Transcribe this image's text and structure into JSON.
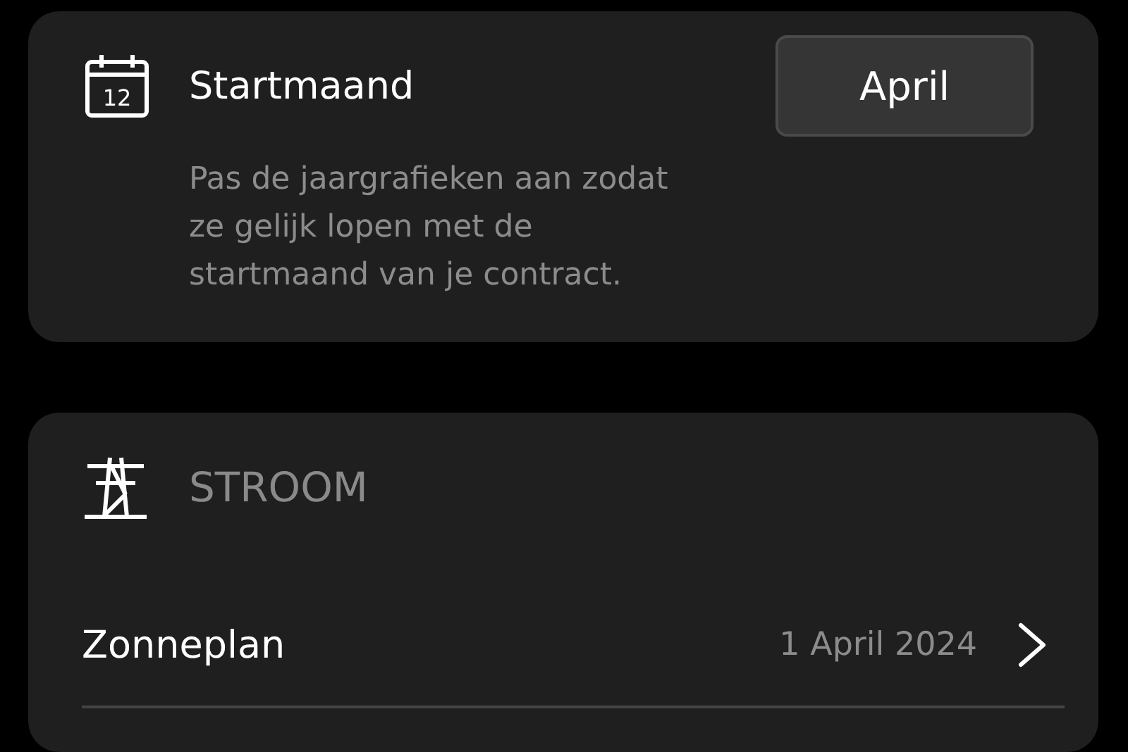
{
  "start_month": {
    "calendar_day": "12",
    "title": "Startmaand",
    "button": "April",
    "description": "Pas de jaargrafieken aan zodat ze gelijk lopen met de startmaand van je contract."
  },
  "electricity": {
    "heading": "STROOM",
    "rows": [
      {
        "name": "Zonneplan",
        "date": "1 April 2024"
      }
    ]
  }
}
